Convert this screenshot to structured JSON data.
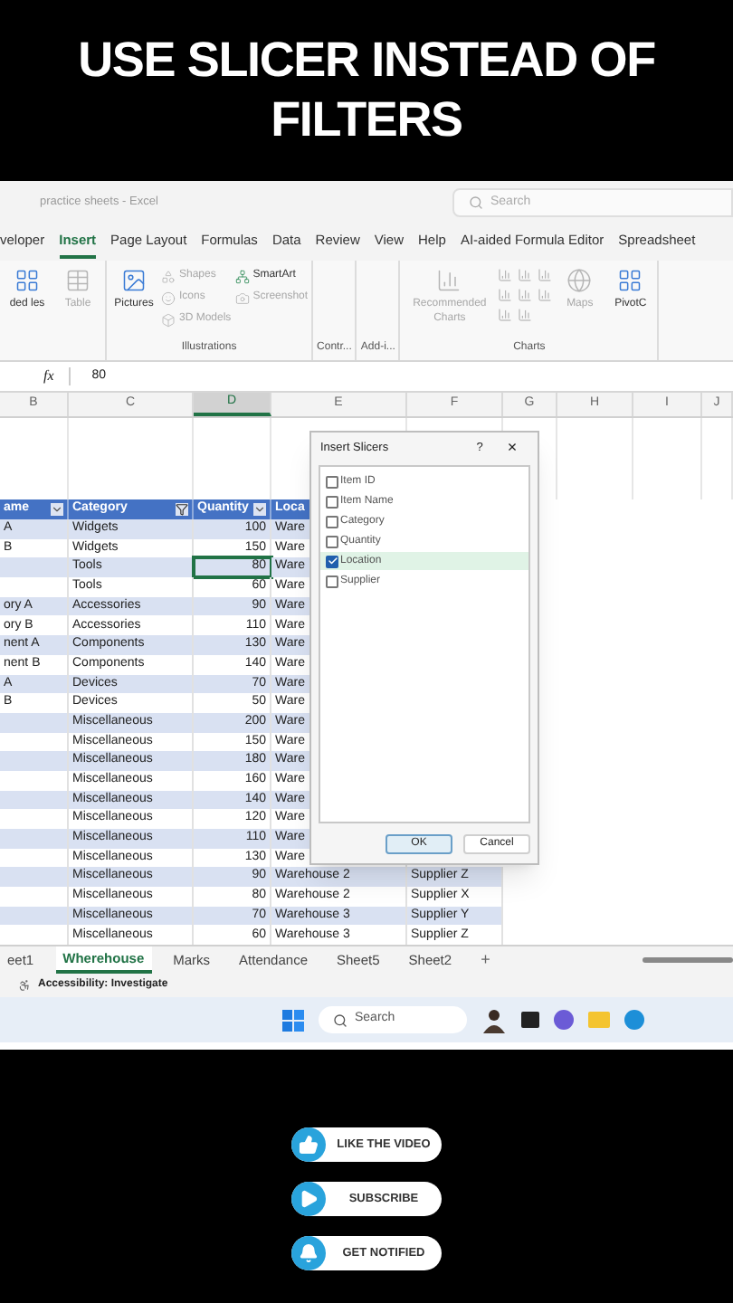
{
  "headline": "USE SLICER INSTEAD OF FILTERS",
  "excel": {
    "title": "practice sheets - Excel",
    "search": {
      "placeholder": "Search"
    },
    "ribbon_tabs": [
      {
        "label": "veloper",
        "selected": false
      },
      {
        "label": "Insert",
        "selected": true
      },
      {
        "label": "Page Layout",
        "selected": false
      },
      {
        "label": "Formulas",
        "selected": false
      },
      {
        "label": "Data",
        "selected": false
      },
      {
        "label": "Review",
        "selected": false
      },
      {
        "label": "View",
        "selected": false
      },
      {
        "label": "Help",
        "selected": false
      },
      {
        "label": "AI-aided Formula Editor",
        "selected": false
      },
      {
        "label": "Spreadsheet",
        "selected": false
      }
    ],
    "ribbon_groups": [
      {
        "items": [
          {
            "kind": "large",
            "label": "ded les",
            "disabled": false
          },
          {
            "kind": "large",
            "label": "Table",
            "disabled": true
          }
        ]
      },
      {
        "name": "Illustrations",
        "items": [
          {
            "kind": "large",
            "label": "Pictures",
            "disabled": false
          },
          {
            "kind": "small",
            "label": "Shapes",
            "disabled": true
          },
          {
            "kind": "small",
            "label": "Icons",
            "disabled": true
          },
          {
            "kind": "small",
            "label": "3D Models",
            "disabled": true
          },
          {
            "kind": "small",
            "label": "SmartArt",
            "disabled": false
          },
          {
            "kind": "small",
            "label": "Screenshot",
            "disabled": true
          }
        ]
      },
      {
        "name": "Contr..."
      },
      {
        "name": "Add-i..."
      },
      {
        "name": "Charts",
        "items": [
          {
            "kind": "large",
            "label": "Recommended Charts",
            "disabled": true
          },
          {
            "kind": "chart-grid"
          },
          {
            "kind": "large",
            "label": "Maps",
            "disabled": true
          },
          {
            "kind": "large",
            "label": "PivotC",
            "disabled": false
          }
        ]
      }
    ],
    "formula_bar": {
      "function_label": "fx",
      "value": "80"
    },
    "columns": [
      {
        "label": "B",
        "selected": false
      },
      {
        "label": "C",
        "selected": false
      },
      {
        "label": "D",
        "selected": true
      },
      {
        "label": "E",
        "selected": false
      },
      {
        "label": "F",
        "selected": false
      },
      {
        "label": "G",
        "selected": false
      },
      {
        "label": "H",
        "selected": false
      },
      {
        "label": "I",
        "selected": false
      },
      {
        "label": "J",
        "selected": false
      }
    ],
    "table": {
      "headers": [
        {
          "label": "ame",
          "filtered": false
        },
        {
          "label": "Category",
          "filtered": true
        },
        {
          "label": "Quantity",
          "filtered": false
        },
        {
          "label": "Loca"
        }
      ],
      "rows": [
        {
          "name": "A",
          "category": "Widgets",
          "quantity": "100",
          "location": "Ware",
          "selected": false
        },
        {
          "name": "B",
          "category": "Widgets",
          "quantity": "150",
          "location": "Ware",
          "selected": false
        },
        {
          "category": "Tools",
          "quantity": "80",
          "location": "Ware",
          "selected": true
        },
        {
          "category": "Tools",
          "quantity": "60",
          "location": "Ware",
          "selected": false
        },
        {
          "name": "ory A",
          "category": "Accessories",
          "quantity": "90",
          "location": "Ware",
          "selected": false
        },
        {
          "name": "ory B",
          "category": "Accessories",
          "quantity": "110",
          "location": "Ware",
          "selected": false
        },
        {
          "name": "nent A",
          "category": "Components",
          "quantity": "130",
          "location": "Ware",
          "selected": false
        },
        {
          "name": "nent B",
          "category": "Components",
          "quantity": "140",
          "location": "Ware",
          "selected": false
        },
        {
          "name": "A",
          "category": "Devices",
          "quantity": "70",
          "location": "Ware",
          "selected": false
        },
        {
          "name": "B",
          "category": "Devices",
          "quantity": "50",
          "location": "Ware",
          "selected": false
        },
        {
          "category": "Miscellaneous",
          "quantity": "200",
          "location": "Ware",
          "selected": false
        },
        {
          "category": "Miscellaneous",
          "quantity": "150",
          "location": "Ware",
          "selected": false
        },
        {
          "category": "Miscellaneous",
          "quantity": "180",
          "location": "Ware",
          "selected": false
        },
        {
          "category": "Miscellaneous",
          "quantity": "160",
          "location": "Ware",
          "selected": false
        },
        {
          "category": "Miscellaneous",
          "quantity": "140",
          "location": "Ware",
          "selected": false
        },
        {
          "category": "Miscellaneous",
          "quantity": "120",
          "location": "Ware",
          "selected": false
        },
        {
          "category": "Miscellaneous",
          "quantity": "110",
          "location": "Ware",
          "selected": false
        },
        {
          "category": "Miscellaneous",
          "quantity": "130",
          "location": "Ware",
          "selected": false
        },
        {
          "category": "Miscellaneous",
          "quantity": "90",
          "location": "Warehouse 2",
          "supplier": "Supplier Z",
          "selected": false
        },
        {
          "category": "Miscellaneous",
          "quantity": "80",
          "location": "Warehouse 2",
          "supplier": "Supplier X",
          "selected": false
        },
        {
          "category": "Miscellaneous",
          "quantity": "70",
          "location": "Warehouse 3",
          "supplier": "Supplier Y",
          "selected": false
        },
        {
          "category": "Miscellaneous",
          "quantity": "60",
          "location": "Warehouse 3",
          "supplier": "Supplier Z",
          "selected": false
        }
      ]
    },
    "dialog": {
      "title": "Insert Slicers",
      "help": "?",
      "close": "×",
      "fields": [
        {
          "label": "Item ID",
          "checked": false
        },
        {
          "label": "Item Name",
          "checked": false
        },
        {
          "label": "Category",
          "checked": false
        },
        {
          "label": "Quantity",
          "checked": false
        },
        {
          "label": "Location",
          "checked": true
        },
        {
          "label": "Supplier",
          "checked": false
        }
      ],
      "buttons": [
        {
          "label": "OK",
          "selected": true
        },
        {
          "label": "Cancel",
          "selected": false
        }
      ]
    },
    "sheet_tabs": [
      {
        "label": "eet1",
        "selected": false
      },
      {
        "label": "Wherehouse",
        "selected": true
      },
      {
        "label": "Marks",
        "selected": false
      },
      {
        "label": "Attendance",
        "selected": false
      },
      {
        "label": "Sheet5",
        "selected": false
      },
      {
        "label": "Sheet2",
        "selected": false
      }
    ],
    "add_sheet": "+",
    "status": "Accessibility: Investigate",
    "taskbar": {
      "search": {
        "placeholder": "Search"
      }
    }
  },
  "buttons": [
    {
      "label": "LIKE THE VIDEO",
      "kind": "like"
    },
    {
      "label": "SUBSCRIBE",
      "kind": "subscribe"
    },
    {
      "label": "GET NOTIFIED",
      "kind": "notify"
    }
  ]
}
